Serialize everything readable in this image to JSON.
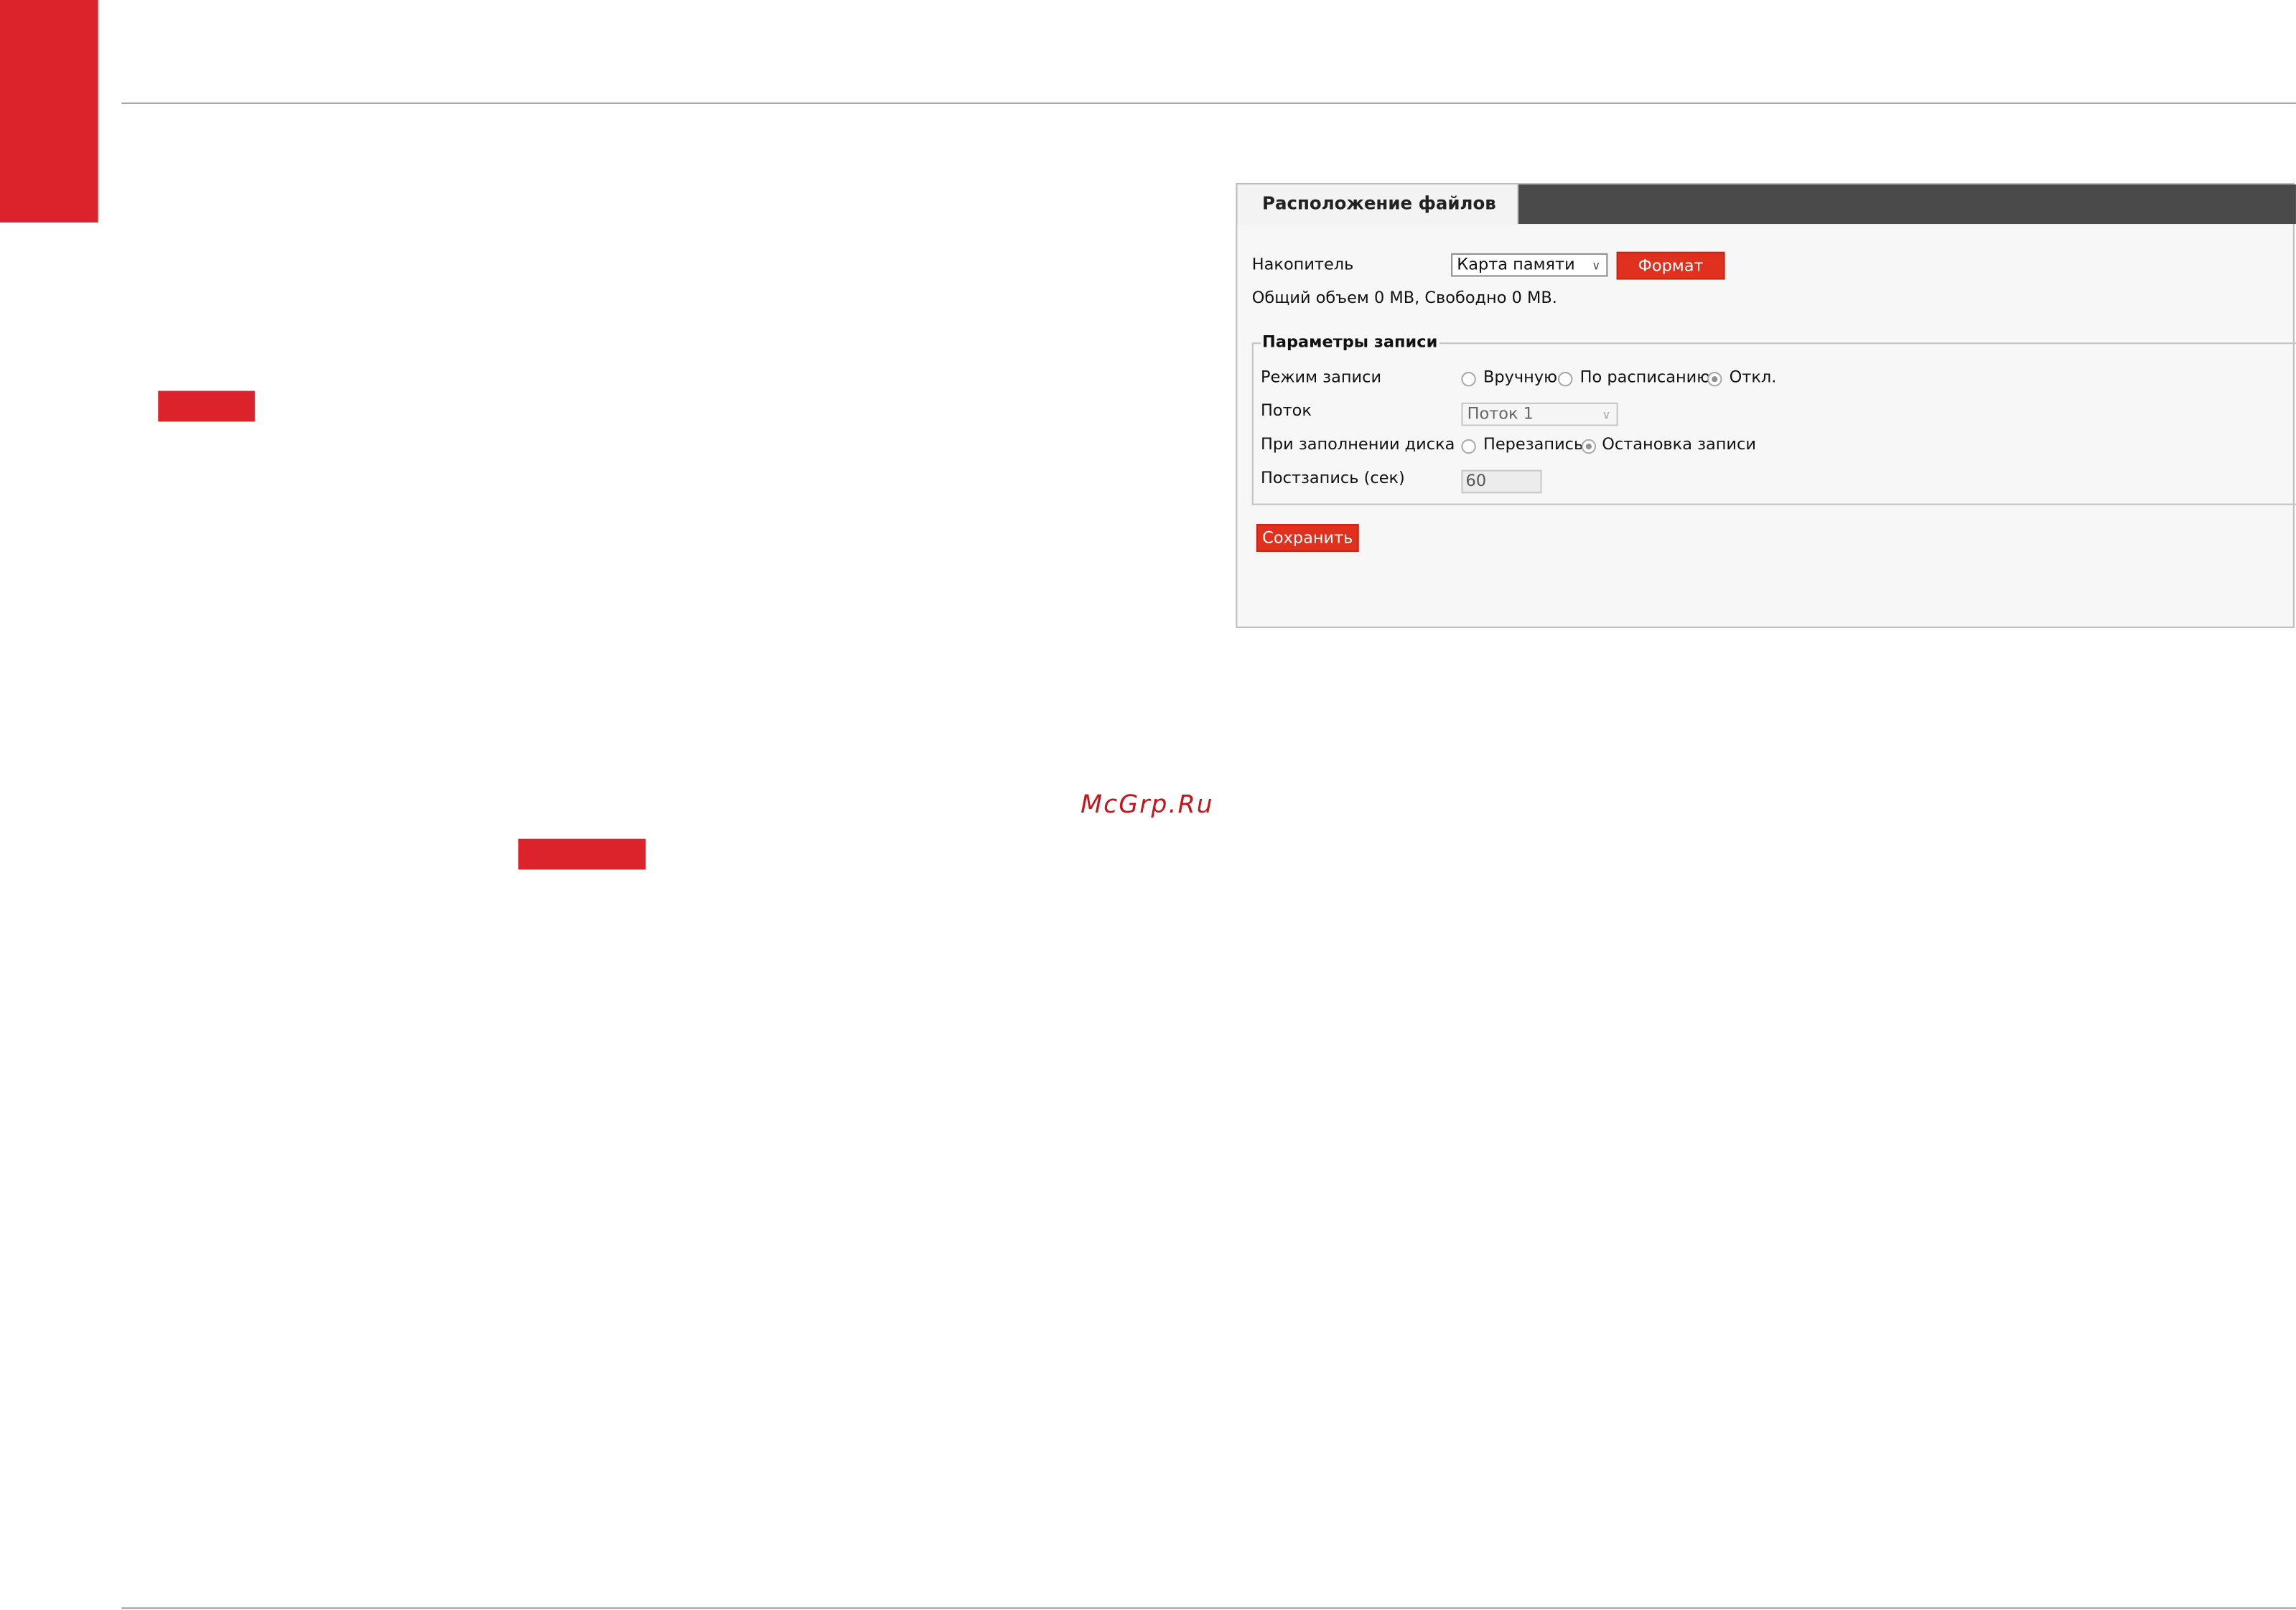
{
  "panel": {
    "tab_title": "Расположение файлов",
    "storage_label": "Накопитель",
    "storage_value": "Карта памяти",
    "format_button": "Формат",
    "capacity_text": "Общий объем 0 MB, Свободно 0 MB.",
    "record_params": {
      "legend": "Параметры записи",
      "record_mode_label": "Режим записи",
      "record_mode_options": [
        "Вручную",
        "По расписанию",
        "Откл."
      ],
      "record_mode_selected": "Откл.",
      "stream_label": "Поток",
      "stream_value": "Поток 1",
      "disk_full_label": "При заполнении диска",
      "disk_full_options": [
        "Перезапись",
        "Остановка записи"
      ],
      "disk_full_selected": "Остановка записи",
      "post_record_label": "Постзапись (сек)",
      "post_record_value": "60"
    },
    "save_button": "Сохранить"
  },
  "watermark": "McGrp.Ru",
  "colors": {
    "accent_red": "#dc232c",
    "button_red": "#e0301e",
    "tabbar_dark": "#4a4a4a"
  }
}
